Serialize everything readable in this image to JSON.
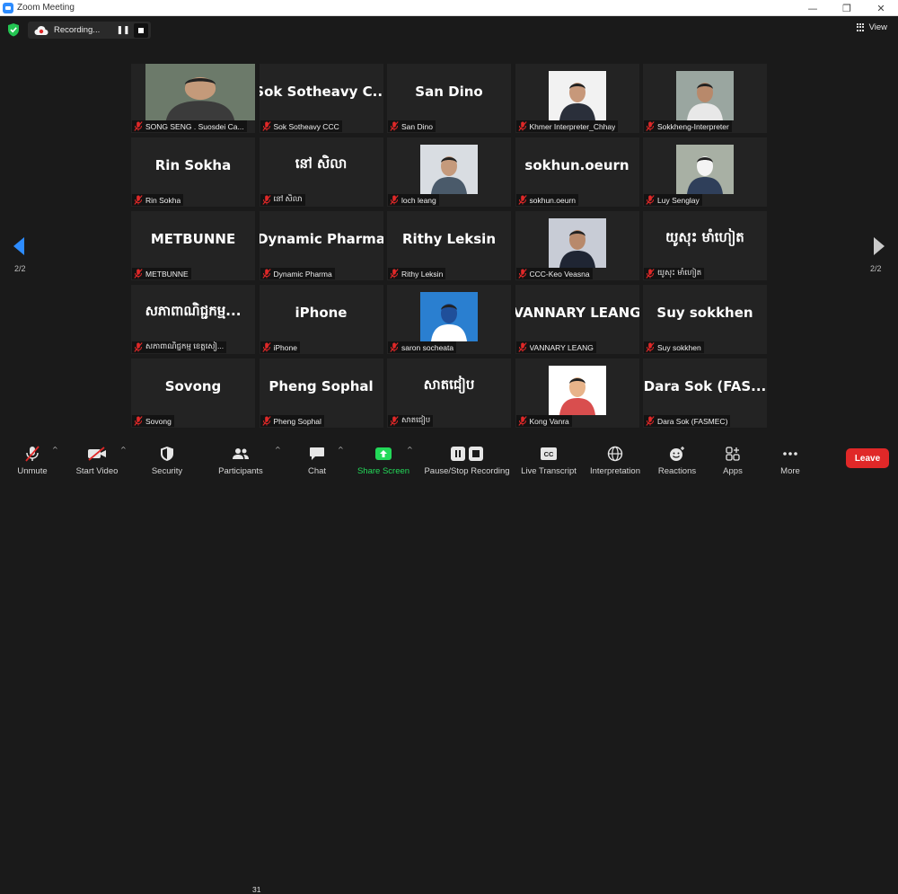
{
  "window": {
    "title": "Zoom Meeting",
    "minimize": "—",
    "restore": "❐",
    "close": "✕"
  },
  "topbar": {
    "recording_label": "Recording...",
    "view_label": "View"
  },
  "colors": {
    "background": "#1a1a1a",
    "tile": "#232323",
    "accent_blue": "#2d8cff",
    "muted_red": "#e02828",
    "share_green": "#23d959"
  },
  "pager": {
    "left_label": "2/2",
    "right_label": "2/2"
  },
  "tiles": [
    {
      "name": "",
      "caption": "SONG SENG . Suosdei Ca..."
    },
    {
      "name": "Sok Sotheavy C...",
      "caption": "Sok Sotheavy CCC"
    },
    {
      "name": "San Dino",
      "caption": "San Dino"
    },
    {
      "name": "",
      "caption": "Khmer Interpreter_Chhay"
    },
    {
      "name": "",
      "caption": "Sokkheng-Interpreter"
    },
    {
      "name": "Rin Sokha",
      "caption": "Rin Sokha"
    },
    {
      "name": "នៅ សិលា",
      "caption": "នៅ សិលា"
    },
    {
      "name": "",
      "caption": "loch leang"
    },
    {
      "name": "sokhun.oeurn",
      "caption": "sokhun.oeurn"
    },
    {
      "name": "",
      "caption": "Luy Senglay"
    },
    {
      "name": "METBUNNE",
      "caption": "METBUNNE"
    },
    {
      "name": "Dynamic Pharma",
      "caption": "Dynamic Pharma"
    },
    {
      "name": "Rithy Leksin",
      "caption": "Rithy Leksin"
    },
    {
      "name": "",
      "caption": "CCC-Keo Veasna"
    },
    {
      "name": "យូសុះ មាំហៀត",
      "caption": "យូសុះ មាំហៀត"
    },
    {
      "name": "សភាពាណិជ្ជកម្ម...",
      "caption": "សភាពាណិជ្ជកម្ម ខេត្តសៀ..."
    },
    {
      "name": "iPhone",
      "caption": "iPhone"
    },
    {
      "name": "",
      "caption": "saron socheata"
    },
    {
      "name": "VANNARY LEANG",
      "caption": "VANNARY LEANG"
    },
    {
      "name": "Suy sokkhen",
      "caption": "Suy sokkhen"
    },
    {
      "name": "Sovong",
      "caption": "Sovong"
    },
    {
      "name": "Pheng Sophal",
      "caption": "Pheng Sophal"
    },
    {
      "name": "សាតជៀប",
      "caption": "សាតជៀប"
    },
    {
      "name": "",
      "caption": "Kong Vanra"
    },
    {
      "name": "Dara Sok (FAS...",
      "caption": "Dara Sok (FASMEC)"
    }
  ],
  "toolbar": {
    "unmute": "Unmute",
    "start_video": "Start Video",
    "security": "Security",
    "participants": "Participants",
    "participants_count": "31",
    "chat": "Chat",
    "share_screen": "Share Screen",
    "pause_stop_recording": "Pause/Stop Recording",
    "live_transcript": "Live Transcript",
    "interpretation": "Interpretation",
    "reactions": "Reactions",
    "apps": "Apps",
    "more": "More",
    "leave": "Leave"
  },
  "icons": {
    "mic_muted": "mic-muted-icon",
    "video_off": "video-off-icon",
    "security": "shield-icon",
    "participants": "people-icon",
    "chat": "chat-bubble-icon",
    "share": "share-arrow-icon",
    "record": "pause-stop-icon",
    "cc": "cc-icon",
    "globe": "globe-icon",
    "reactions": "smiley-icon",
    "apps": "apps-icon",
    "more": "ellipsis-icon"
  }
}
